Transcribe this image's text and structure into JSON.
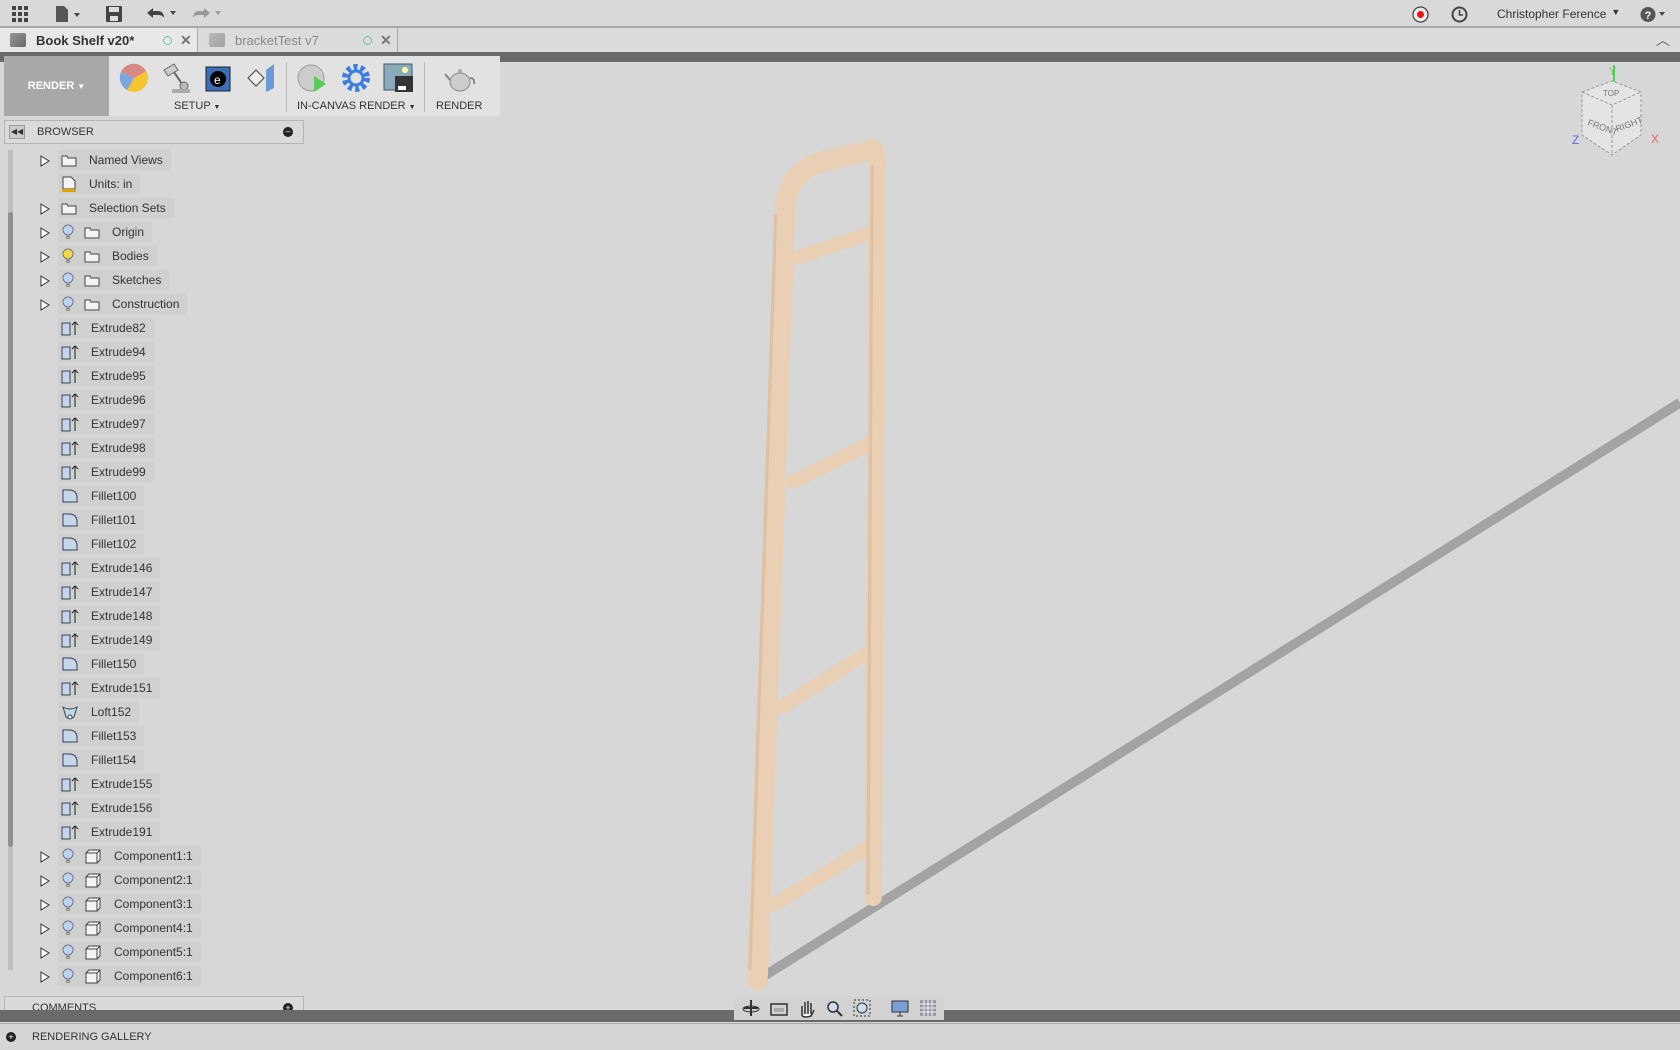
{
  "topbar": {
    "user_name": "Christopher Ference",
    "icons": [
      "app-grid-icon",
      "file-icon",
      "save-icon",
      "undo-icon",
      "redo-icon",
      "record-icon",
      "clock-icon",
      "help-icon"
    ]
  },
  "tabs": [
    {
      "label": "Book Shelf v20*",
      "active": true
    },
    {
      "label": "bracketTest v7",
      "active": false
    }
  ],
  "toolbar": {
    "workspace": "RENDER",
    "groups": [
      {
        "label": "SETUP"
      },
      {
        "label": "IN-CANVAS RENDER"
      },
      {
        "label": "RENDER"
      }
    ]
  },
  "browser": {
    "title": "BROWSER",
    "items": [
      {
        "label": "Named Views",
        "icon": "folder",
        "expand": true,
        "bulb": null,
        "indent": 0
      },
      {
        "label": "Units: in",
        "icon": "units",
        "expand": false,
        "bulb": null,
        "indent": 0
      },
      {
        "label": "Selection Sets",
        "icon": "folder",
        "expand": true,
        "bulb": null,
        "indent": 0
      },
      {
        "label": "Origin",
        "icon": "folder",
        "expand": true,
        "bulb": "off",
        "indent": 1
      },
      {
        "label": "Bodies",
        "icon": "folder",
        "expand": true,
        "bulb": "on",
        "indent": 1
      },
      {
        "label": "Sketches",
        "icon": "folder",
        "expand": true,
        "bulb": "off",
        "indent": 1
      },
      {
        "label": "Construction",
        "icon": "folder",
        "expand": true,
        "bulb": "off",
        "indent": 1
      },
      {
        "label": "Extrude82",
        "icon": "extrude",
        "expand": false,
        "bulb": null,
        "indent": 0
      },
      {
        "label": "Extrude94",
        "icon": "extrude",
        "expand": false,
        "bulb": null,
        "indent": 0
      },
      {
        "label": "Extrude95",
        "icon": "extrude",
        "expand": false,
        "bulb": null,
        "indent": 0
      },
      {
        "label": "Extrude96",
        "icon": "extrude",
        "expand": false,
        "bulb": null,
        "indent": 0
      },
      {
        "label": "Extrude97",
        "icon": "extrude",
        "expand": false,
        "bulb": null,
        "indent": 0
      },
      {
        "label": "Extrude98",
        "icon": "extrude",
        "expand": false,
        "bulb": null,
        "indent": 0
      },
      {
        "label": "Extrude99",
        "icon": "extrude",
        "expand": false,
        "bulb": null,
        "indent": 0
      },
      {
        "label": "Fillet100",
        "icon": "fillet",
        "expand": false,
        "bulb": null,
        "indent": 0
      },
      {
        "label": "Fillet101",
        "icon": "fillet",
        "expand": false,
        "bulb": null,
        "indent": 0
      },
      {
        "label": "Fillet102",
        "icon": "fillet",
        "expand": false,
        "bulb": null,
        "indent": 0
      },
      {
        "label": "Extrude146",
        "icon": "extrude",
        "expand": false,
        "bulb": null,
        "indent": 0
      },
      {
        "label": "Extrude147",
        "icon": "extrude",
        "expand": false,
        "bulb": null,
        "indent": 0
      },
      {
        "label": "Extrude148",
        "icon": "extrude",
        "expand": false,
        "bulb": null,
        "indent": 0
      },
      {
        "label": "Extrude149",
        "icon": "extrude",
        "expand": false,
        "bulb": null,
        "indent": 0
      },
      {
        "label": "Fillet150",
        "icon": "fillet",
        "expand": false,
        "bulb": null,
        "indent": 0
      },
      {
        "label": "Extrude151",
        "icon": "extrude",
        "expand": false,
        "bulb": null,
        "indent": 0
      },
      {
        "label": "Loft152",
        "icon": "loft",
        "expand": false,
        "bulb": null,
        "indent": 0
      },
      {
        "label": "Fillet153",
        "icon": "fillet",
        "expand": false,
        "bulb": null,
        "indent": 0
      },
      {
        "label": "Fillet154",
        "icon": "fillet",
        "expand": false,
        "bulb": null,
        "indent": 0
      },
      {
        "label": "Extrude155",
        "icon": "extrude",
        "expand": false,
        "bulb": null,
        "indent": 0
      },
      {
        "label": "Extrude156",
        "icon": "extrude",
        "expand": false,
        "bulb": null,
        "indent": 0
      },
      {
        "label": "Extrude191",
        "icon": "extrude",
        "expand": false,
        "bulb": null,
        "indent": 0
      },
      {
        "label": "Component1:1",
        "icon": "component",
        "expand": true,
        "bulb": "off",
        "indent": 1
      },
      {
        "label": "Component2:1",
        "icon": "component",
        "expand": true,
        "bulb": "off",
        "indent": 1
      },
      {
        "label": "Component3:1",
        "icon": "component",
        "expand": true,
        "bulb": "off",
        "indent": 1
      },
      {
        "label": "Component4:1",
        "icon": "component",
        "expand": true,
        "bulb": "off",
        "indent": 1
      },
      {
        "label": "Component5:1",
        "icon": "component",
        "expand": true,
        "bulb": "off",
        "indent": 1
      },
      {
        "label": "Component6:1",
        "icon": "component",
        "expand": true,
        "bulb": "off",
        "indent": 1
      }
    ]
  },
  "comments": {
    "title": "COMMENTS"
  },
  "gallery": {
    "title": "RENDERING GALLERY"
  },
  "viewcube": {
    "top": "TOP",
    "front": "FRONT",
    "right": "RIGHT",
    "x": "X",
    "y": "Y",
    "z": "Z"
  },
  "colors": {
    "wood": "#e9cfb3",
    "floor": "#a3a3a3",
    "accent_record": "#e11"
  }
}
